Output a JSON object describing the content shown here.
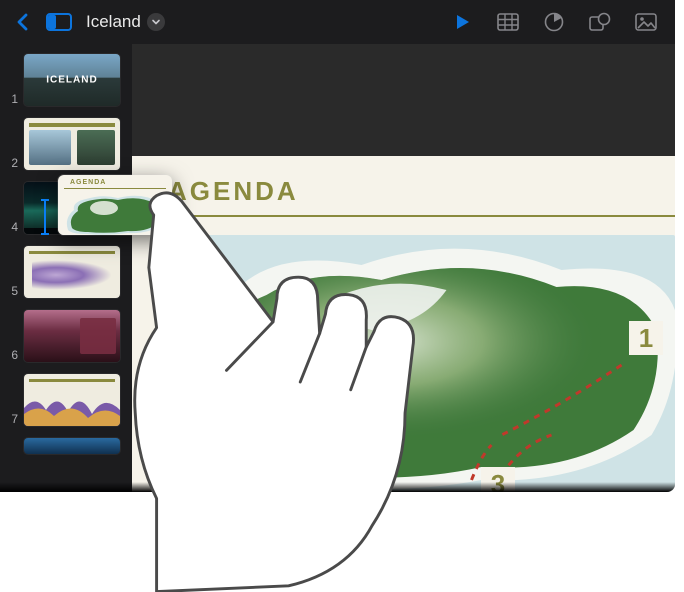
{
  "header": {
    "doc_title": "Iceland"
  },
  "sidebar": {
    "items": [
      {
        "num": "1",
        "label": "ICELAND"
      },
      {
        "num": "2",
        "label": ""
      },
      {
        "num": "4",
        "label": ""
      },
      {
        "num": "5",
        "label": ""
      },
      {
        "num": "6",
        "label": ""
      },
      {
        "num": "7",
        "label": ""
      }
    ]
  },
  "drag": {
    "mini_title": "AGENDA"
  },
  "slide": {
    "title": "AGENDA",
    "markers": [
      "1",
      "3"
    ]
  },
  "colors": {
    "accent_blue": "#0a84ff",
    "olive": "#8a8a3e"
  }
}
